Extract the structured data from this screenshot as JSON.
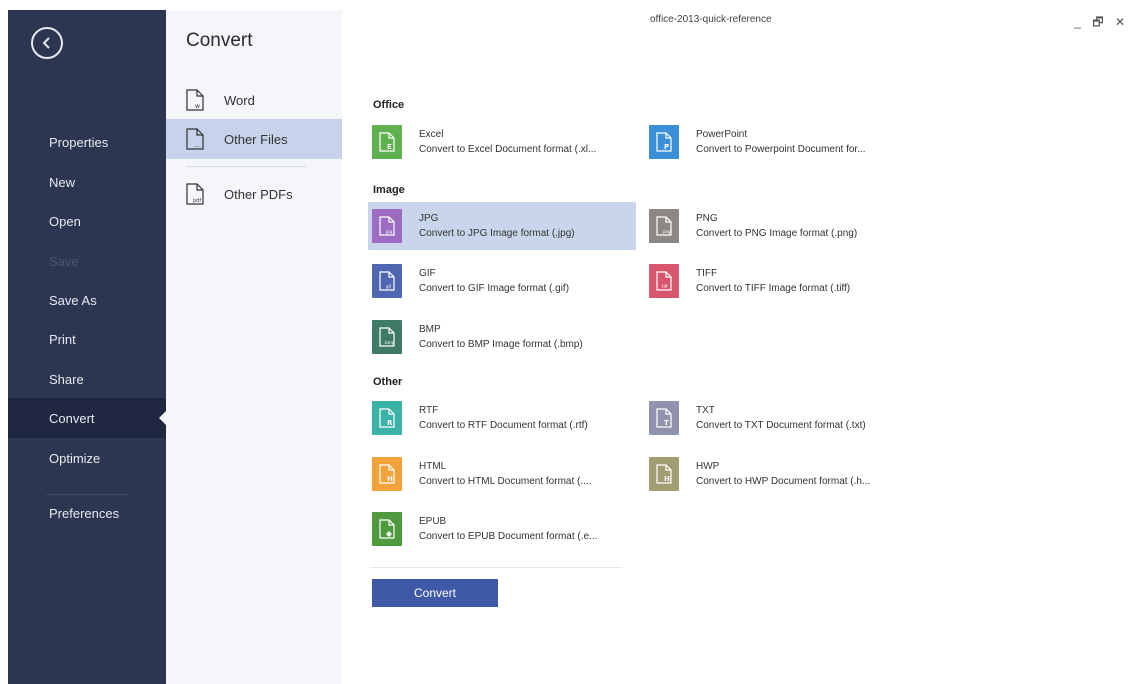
{
  "window": {
    "title": "office-2013-quick-reference",
    "controls": [
      "_",
      "🗗",
      "✕"
    ]
  },
  "nav": {
    "items": [
      {
        "label": "Properties"
      },
      {
        "label": "New"
      },
      {
        "label": "Open"
      },
      {
        "label": "Save",
        "disabled": true
      },
      {
        "label": "Save As"
      },
      {
        "label": "Print"
      },
      {
        "label": "Share"
      },
      {
        "label": "Convert",
        "active": true
      },
      {
        "label": "Optimize"
      },
      {
        "label": "Preferences"
      }
    ]
  },
  "convert_panel": {
    "title": "Convert",
    "items": [
      {
        "label": "Word",
        "icon_tag": "w"
      },
      {
        "label": "Other Files",
        "icon_tag": "...",
        "active": true
      },
      {
        "label": "Other PDFs",
        "icon_tag": "pdf"
      }
    ]
  },
  "sections": {
    "office": {
      "title": "Office",
      "formats": [
        {
          "name": "Excel",
          "desc": "Convert to Excel Document format (.xl...",
          "color": "#5fb04f",
          "tag": "E"
        },
        {
          "name": "PowerPoint",
          "desc": "Convert to Powerpoint Document for...",
          "color": "#3b8fd6",
          "tag": "P"
        }
      ]
    },
    "image": {
      "title": "Image",
      "formats": [
        {
          "name": "JPG",
          "desc": "Convert to JPG Image format (.jpg)",
          "color": "#9b6cc2",
          "tag": "jpg",
          "selected": true
        },
        {
          "name": "PNG",
          "desc": "Convert to PNG Image format (.png)",
          "color": "#8c8685",
          "tag": "png"
        },
        {
          "name": "GIF",
          "desc": "Convert to GIF Image format (.gif)",
          "color": "#4f66b0",
          "tag": "gif"
        },
        {
          "name": "TIFF",
          "desc": "Convert to TIFF Image format (.tiff)",
          "color": "#d8576f",
          "tag": "tiff"
        },
        {
          "name": "BMP",
          "desc": "Convert to BMP Image format (.bmp)",
          "color": "#3f7a68",
          "tag": "bmp"
        }
      ]
    },
    "other": {
      "title": "Other",
      "formats": [
        {
          "name": "RTF",
          "desc": "Convert to RTF Document format (.rtf)",
          "color": "#3ab3a6",
          "tag": "R"
        },
        {
          "name": "TXT",
          "desc": "Convert to TXT Document format (.txt)",
          "color": "#8f93ad",
          "tag": "T"
        },
        {
          "name": "HTML",
          "desc": "Convert to HTML Document format (....",
          "color": "#f2a23a",
          "tag": "H"
        },
        {
          "name": "HWP",
          "desc": "Convert to HWP Document format (.h...",
          "color": "#a39d74",
          "tag": "H"
        },
        {
          "name": "EPUB",
          "desc": "Convert to EPUB Document format (.e...",
          "color": "#4f9a3f",
          "tag": "◆"
        }
      ]
    }
  },
  "convert_button": "Convert"
}
